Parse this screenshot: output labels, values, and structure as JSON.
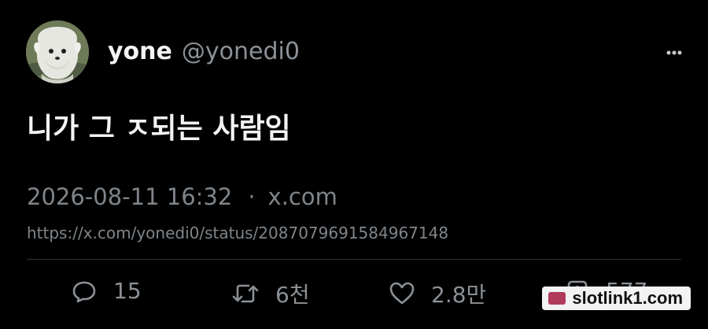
{
  "author": {
    "display_name": "yone",
    "handle": "@yonedi0",
    "avatar_icon": "avatar-icon"
  },
  "tweet": {
    "text": "니가 그 ㅈ되는 사람임",
    "timestamp": "2026-08-11 16:32",
    "separator": "·",
    "source": "x.com",
    "status_url": "https://x.com/yonedi0/status/2087079691584967148"
  },
  "actions": {
    "reply_count": "15",
    "repost_count": "6천",
    "like_count": "2.8만",
    "view_count": "577"
  },
  "icons": {
    "more": "more-options-icon",
    "reply": "reply-icon",
    "repost": "repost-icon",
    "like": "heart-icon",
    "views": "views-icon"
  },
  "watermark": {
    "text": "slotlink1.com"
  },
  "colors": {
    "background": "#000000",
    "primary_text": "#f3f3f3",
    "secondary_text": "#8b9196",
    "divider": "#2f3336"
  }
}
